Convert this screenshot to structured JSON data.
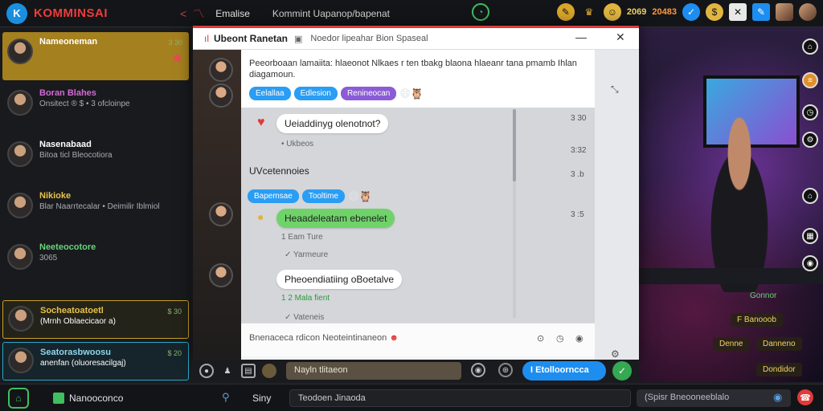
{
  "app": {
    "logo": "K",
    "title": "KOMMINSAI",
    "tab_label": "Emalise",
    "tab_subtitle": "Kommint Uapanop/bapenat",
    "stat_value": "2069",
    "stat_value2": "20483"
  },
  "sidebar": {
    "items": [
      {
        "name": "Nameoneman",
        "sub": "",
        "time": "3 30"
      },
      {
        "name": "Boran Blahes",
        "sub": "Onsitect ® $  •  3 ofcloinpe",
        "time": ""
      },
      {
        "name": "Nasenabaad",
        "sub": "Bitoa ticl Bleocotiora",
        "time": ""
      },
      {
        "name": "Nikioke",
        "sub": "Blar Naarrtecalar  •  Deimilir Iblmiol",
        "time": ""
      },
      {
        "name": "Neeteocotore",
        "sub": "3065",
        "time": ""
      },
      {
        "name": "Socheatoatoetl",
        "sub": "(Mrnh Oblaecicaor a)",
        "time": "$ 30"
      },
      {
        "name": "Seatorasbwoosu",
        "sub": "anenfan (oluoresacilgaj)",
        "time": "$ 20"
      }
    ]
  },
  "dialog": {
    "title": "Ubeont Ranetan",
    "subtitle": "Noedor lipeahar  Bion Spaseal",
    "intro_text": "Peeorboaan lamaiita: hlaeonot Nlkaes r ten tbakg blaona hlaeanr tana pmamb Ihlan diagamoun.",
    "chips": [
      "Eelallaa",
      "Edlesion",
      "Renineocan"
    ],
    "messages": [
      {
        "text": "Ueiaddinyg olenotnot?",
        "meta": "• Ukbeos"
      },
      {
        "text": "UVcetennoies",
        "meta": ""
      },
      {
        "text": "Heaadeleatam ebenelet",
        "meta": "1 Eam Ture",
        "meta2": "✓ Yarmeure"
      },
      {
        "text": "Pheoendiatiing oBoetalve",
        "meta": "1 2 Mala fient",
        "meta2": "✓ Vateneis"
      }
    ],
    "chips2": [
      "Bapemsae",
      "Tooltime"
    ],
    "times": [
      "3 30",
      "3:32",
      "3 .b",
      "3 :5"
    ],
    "reaction_prompt": "Bnenaceca rdicon Neoteintinaneon"
  },
  "toolbar": {
    "input_value": "Nayln tlitaeon",
    "send_label": "I Etolloorncca"
  },
  "bottombar": {
    "label": "Nanooconco",
    "left_text": "Siny",
    "input_value": "Teodoen Jinaoda",
    "search_value": "(Spisr  Bneooneeblalo"
  },
  "video": {
    "labels": [
      "Gonnor",
      "F Banooob",
      "Denne",
      "Danneno",
      "Dondidor"
    ]
  },
  "colors": {
    "accent_red": "#e03a3a",
    "accent_blue": "#1d8ef0",
    "accent_green": "#34a852",
    "sidebar_active": "#a5801f"
  }
}
